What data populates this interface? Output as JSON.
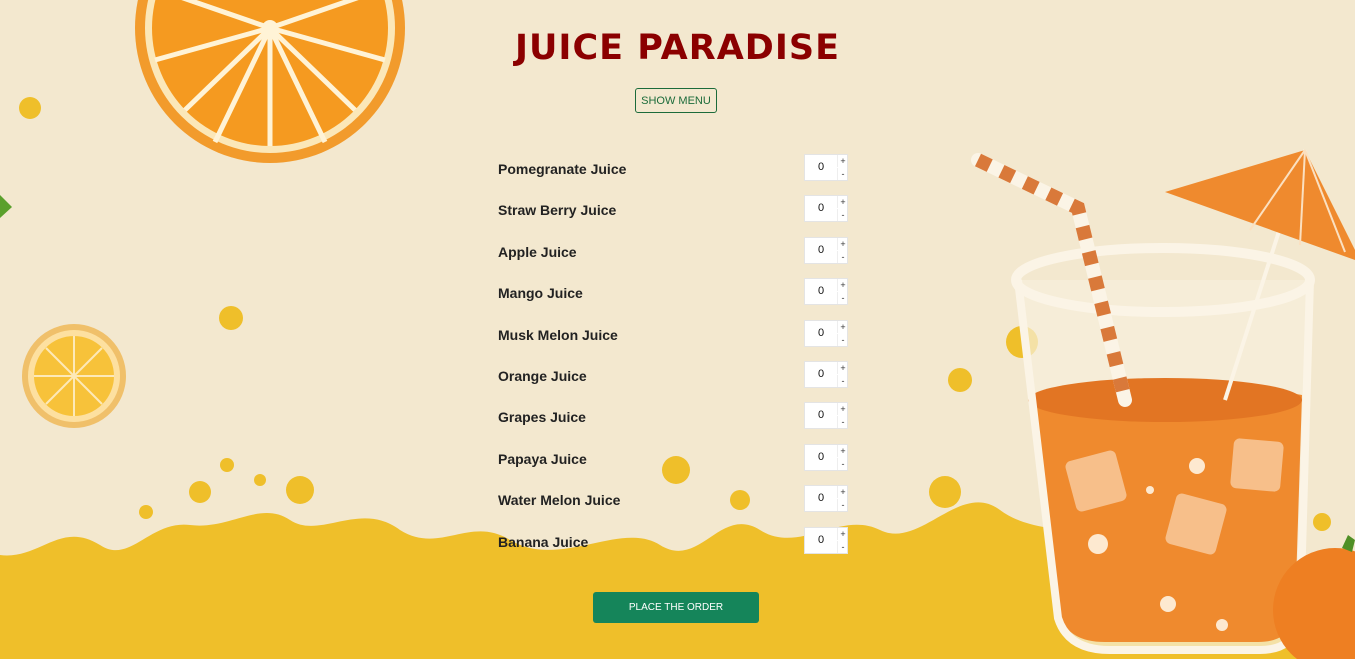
{
  "header": {
    "title": "JUICE PARADISE"
  },
  "toolbar": {
    "show_menu_label": "SHOW MENU"
  },
  "menu": {
    "items": [
      {
        "name": "Pomegranate Juice",
        "quantity": "0"
      },
      {
        "name": "Straw Berry Juice",
        "quantity": "0"
      },
      {
        "name": "Apple Juice",
        "quantity": "0"
      },
      {
        "name": "Mango Juice",
        "quantity": "0"
      },
      {
        "name": "Musk Melon Juice",
        "quantity": "0"
      },
      {
        "name": "Orange Juice",
        "quantity": "0"
      },
      {
        "name": "Grapes Juice",
        "quantity": "0"
      },
      {
        "name": "Papaya Juice",
        "quantity": "0"
      },
      {
        "name": "Water Melon Juice",
        "quantity": "0"
      },
      {
        "name": "Banana Juice",
        "quantity": "0"
      }
    ],
    "increment_symbol": "+",
    "decrement_symbol": "-"
  },
  "order": {
    "place_order_label": "PLACE THE ORDER"
  },
  "colors": {
    "background": "#f3e8cf",
    "title": "#8b0000",
    "accent_green": "#15855a",
    "splash_yellow": "#efbf2a",
    "orange": "#f08a2a"
  }
}
